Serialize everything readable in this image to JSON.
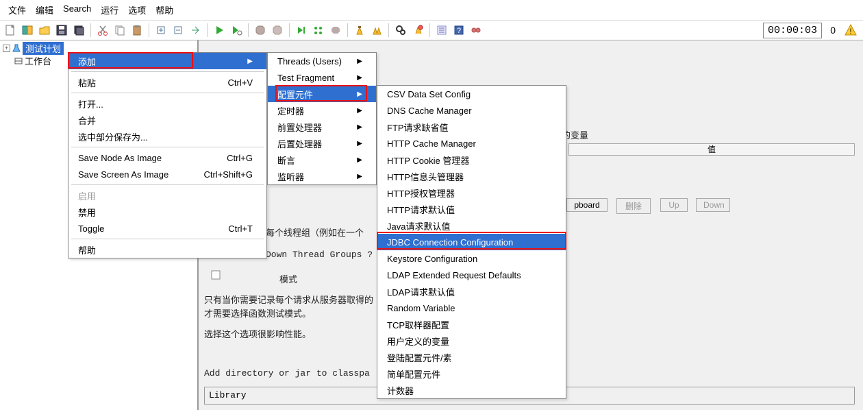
{
  "menubar": [
    "文件",
    "编辑",
    "Search",
    "运行",
    "选项",
    "帮助"
  ],
  "timer": "00:00:03",
  "zerocount": "0",
  "tree": {
    "selected": "测试计划",
    "child": "工作台"
  },
  "ctx1": {
    "items": [
      {
        "label": "添加",
        "arrow": true,
        "hl": true
      },
      {
        "sep": true
      },
      {
        "label": "粘贴",
        "shortcut": "Ctrl+V"
      },
      {
        "sep": true
      },
      {
        "label": "打开..."
      },
      {
        "label": "合并"
      },
      {
        "label": "选中部分保存为..."
      },
      {
        "sep": true
      },
      {
        "label": "Save Node As Image",
        "shortcut": "Ctrl+G"
      },
      {
        "label": "Save Screen As Image",
        "shortcut": "Ctrl+Shift+G"
      },
      {
        "sep": true
      },
      {
        "label": "启用",
        "dis": true
      },
      {
        "label": "禁用"
      },
      {
        "label": "Toggle",
        "shortcut": "Ctrl+T"
      },
      {
        "sep": true
      },
      {
        "label": "帮助"
      }
    ]
  },
  "ctx2": {
    "items": [
      {
        "label": "Threads (Users)",
        "arrow": true
      },
      {
        "label": "Test Fragment",
        "arrow": true
      },
      {
        "label": "配置元件",
        "arrow": true,
        "hl": true
      },
      {
        "label": "定时器",
        "arrow": true
      },
      {
        "label": "前置处理器",
        "arrow": true
      },
      {
        "label": "后置处理器",
        "arrow": true
      },
      {
        "label": "断言",
        "arrow": true
      },
      {
        "label": "监听器",
        "arrow": true
      }
    ]
  },
  "ctx3": {
    "items": [
      "CSV Data Set Config",
      "DNS Cache Manager",
      "FTP请求缺省值",
      "HTTP Cache Manager",
      "HTTP Cookie 管理器",
      "HTTP信息头管理器",
      "HTTP授权管理器",
      "HTTP请求默认值",
      "Java请求默认值",
      "JDBC Connection Configuration",
      "Keystore Configuration",
      "LDAP Extended Request Defaults",
      "LDAP请求默认值",
      "Random Variable",
      "TCP取样器配置",
      "用户定义的变量",
      "登陆配置元件/素",
      "简单配置元件",
      "计数器"
    ],
    "hl_index": 9
  },
  "bg": {
    "var_label": "的变量",
    "col_value": "值",
    "btn_board": "pboard",
    "btn_delete": "删除",
    "btn_up": "Up",
    "btn_down": "Down",
    "line1": "每个线程组（例如在一个",
    "line2": "Down Thread Groups ?",
    "mode": "模式",
    "desc1": "只有当你需要记录每个请求从服务器取得的",
    "desc2": "才需要选择函数测试模式。",
    "desc3": "选择这个选项很影响性能。",
    "addjar": "Add directory or jar to classpa",
    "library": "Library"
  }
}
